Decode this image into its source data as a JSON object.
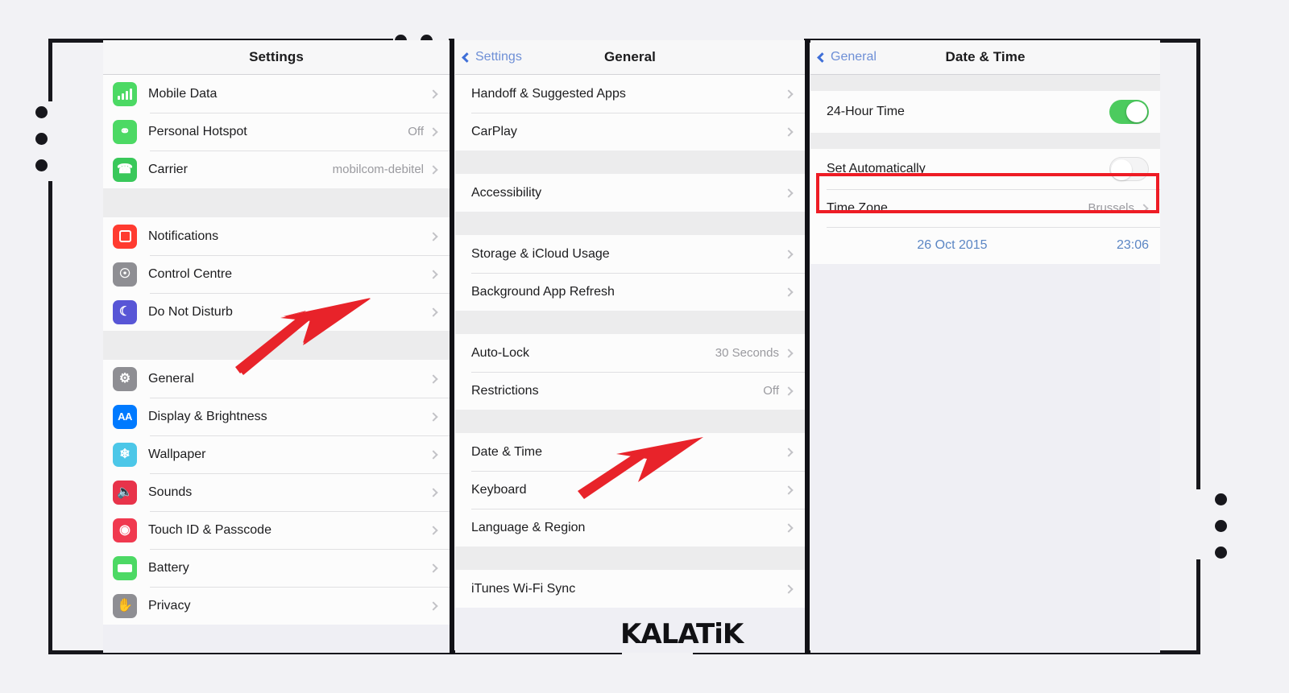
{
  "watermark": "KALATiK",
  "colors": {
    "accent_red": "#ee1c25",
    "toggle_on_green": "#4ccb5e",
    "link_blue": "#3f6fd8",
    "value_grey": "#9a9a9f",
    "page_background": "#f2f2f5"
  },
  "panels": {
    "settings": {
      "nav": {
        "title": "Settings"
      },
      "groups": [
        {
          "rows": [
            {
              "label": "Mobile Data",
              "value": "",
              "icon": "cellular-icon",
              "icon_color": "#4cd964",
              "chevron": true
            },
            {
              "label": "Personal Hotspot",
              "value": "Off",
              "icon": "hotspot-icon",
              "icon_color": "#4cd964",
              "chevron": true
            },
            {
              "label": "Carrier",
              "value": "mobilcom-debitel",
              "icon": "phone-icon",
              "icon_color": "#39c85a",
              "chevron": true
            }
          ]
        },
        {
          "rows": [
            {
              "label": "Notifications",
              "value": "",
              "icon": "notifications-icon",
              "icon_color": "#ff3b30",
              "chevron": true
            },
            {
              "label": "Control Centre",
              "value": "",
              "icon": "control-centre-icon",
              "icon_color": "#8e8e93",
              "chevron": true
            },
            {
              "label": "Do Not Disturb",
              "value": "",
              "icon": "moon-icon",
              "icon_color": "#5856d6",
              "chevron": true
            }
          ]
        },
        {
          "rows": [
            {
              "label": "General",
              "value": "",
              "icon": "gear-icon",
              "icon_color": "#8e8e93",
              "chevron": true
            },
            {
              "label": "Display & Brightness",
              "value": "",
              "icon": "display-icon",
              "icon_color": "#007aff",
              "chevron": true
            },
            {
              "label": "Wallpaper",
              "value": "",
              "icon": "wallpaper-icon",
              "icon_color": "#4cc7e8",
              "chevron": true
            },
            {
              "label": "Sounds",
              "value": "",
              "icon": "speaker-icon",
              "icon_color": "#e8334a",
              "chevron": true
            },
            {
              "label": "Touch ID & Passcode",
              "value": "",
              "icon": "fingerprint-icon",
              "icon_color": "#f0394f",
              "chevron": true
            },
            {
              "label": "Battery",
              "value": "",
              "icon": "battery-icon",
              "icon_color": "#4cd964",
              "chevron": true
            },
            {
              "label": "Privacy",
              "value": "",
              "icon": "hand-icon",
              "icon_color": "#8e8e93",
              "chevron": true
            }
          ]
        }
      ]
    },
    "general": {
      "nav": {
        "back_label": "Settings",
        "title": "General"
      },
      "groups": [
        {
          "rows": [
            {
              "label": "Handoff & Suggested Apps",
              "value": "",
              "chevron": true
            },
            {
              "label": "CarPlay",
              "value": "",
              "chevron": true
            }
          ]
        },
        {
          "rows": [
            {
              "label": "Accessibility",
              "value": "",
              "chevron": true
            }
          ]
        },
        {
          "rows": [
            {
              "label": "Storage & iCloud Usage",
              "value": "",
              "chevron": true
            },
            {
              "label": "Background App Refresh",
              "value": "",
              "chevron": true
            }
          ]
        },
        {
          "rows": [
            {
              "label": "Auto-Lock",
              "value": "30 Seconds",
              "chevron": true
            },
            {
              "label": "Restrictions",
              "value": "Off",
              "chevron": true
            }
          ]
        },
        {
          "rows": [
            {
              "label": "Date & Time",
              "value": "",
              "chevron": true
            },
            {
              "label": "Keyboard",
              "value": "",
              "chevron": true
            },
            {
              "label": "Language & Region",
              "value": "",
              "chevron": true
            }
          ]
        },
        {
          "rows": [
            {
              "label": "iTunes Wi-Fi Sync",
              "value": "",
              "chevron": true
            }
          ]
        }
      ]
    },
    "datetime": {
      "nav": {
        "back_label": "General",
        "title": "Date & Time"
      },
      "rows_24h": {
        "label": "24-Hour Time",
        "toggle": "on"
      },
      "rows_auto": {
        "label": "Set Automatically",
        "toggle": "off"
      },
      "rows_timezone": {
        "label": "Time Zone",
        "value": "Brussels",
        "chevron": true
      },
      "current": {
        "date": "26 Oct 2015",
        "time": "23:06"
      }
    }
  },
  "annotations": {
    "arrow_general": "red-arrow-pointing-to-general",
    "arrow_datetime": "red-arrow-pointing-to-date-and-time",
    "highlight": "red-box-around-set-automatically"
  }
}
